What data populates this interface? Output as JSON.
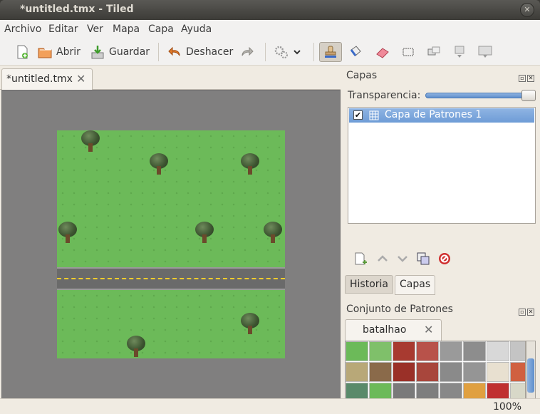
{
  "window": {
    "title": "*untitled.tmx - Tiled"
  },
  "menu": {
    "items": [
      "Archivo",
      "Editar",
      "Ver",
      "Mapa",
      "Capa",
      "Ayuda"
    ]
  },
  "toolbar": {
    "open_label": "Abrir",
    "save_label": "Guardar",
    "undo_label": "Deshacer"
  },
  "document": {
    "tab_label": "*untitled.tmx"
  },
  "layers_panel": {
    "title": "Capas",
    "opacity_label": "Transparencia:",
    "opacity": 1.0,
    "layers": [
      {
        "name": "Capa de Patrones 1",
        "visible": true,
        "selected": true
      }
    ]
  },
  "bottom_tabs": {
    "history": "Historia",
    "layers": "Capas",
    "active": "Capas"
  },
  "tilesets_panel": {
    "title": "Conjunto de Patrones",
    "tab_label": "batalhao"
  },
  "status": {
    "zoom": "100%"
  },
  "colors": {
    "selection": "#6e9cd6",
    "grass": "#6cba59",
    "road": "#6a6a6a",
    "road_line": "#f0cc2c",
    "canvas_bg": "#807f7f"
  }
}
